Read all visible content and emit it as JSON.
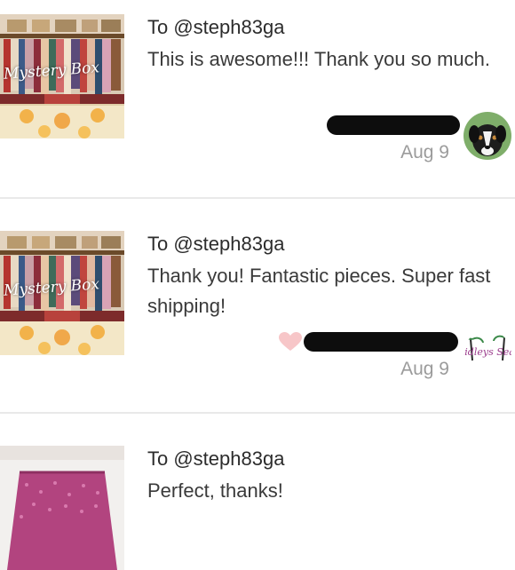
{
  "reviews": [
    {
      "recipient": "To @steph83ga",
      "message": "This is awesome!!! Thank you so much.",
      "date": "Aug 9",
      "thumbnail_label": "Mystery Box",
      "avatar_icon": "dog-avatar-icon",
      "has_heart": false
    },
    {
      "recipient": "To @steph83ga",
      "message": "Thank you! Fantastic pieces. Super fast shipping!",
      "date": "Aug 9",
      "thumbnail_label": "Mystery Box",
      "avatar_icon": "palm-logo-avatar-icon",
      "avatar_text": "Chidleys Seam",
      "has_heart": true
    },
    {
      "recipient": "To @steph83ga",
      "message": "Perfect, thanks!",
      "thumbnail_icon": "pink-skirt-icon"
    }
  ],
  "colors": {
    "heart": "#f7c6c8",
    "date": "#9b9b9b",
    "divider": "#e9e9e9",
    "redaction": "#0d0d0d"
  }
}
